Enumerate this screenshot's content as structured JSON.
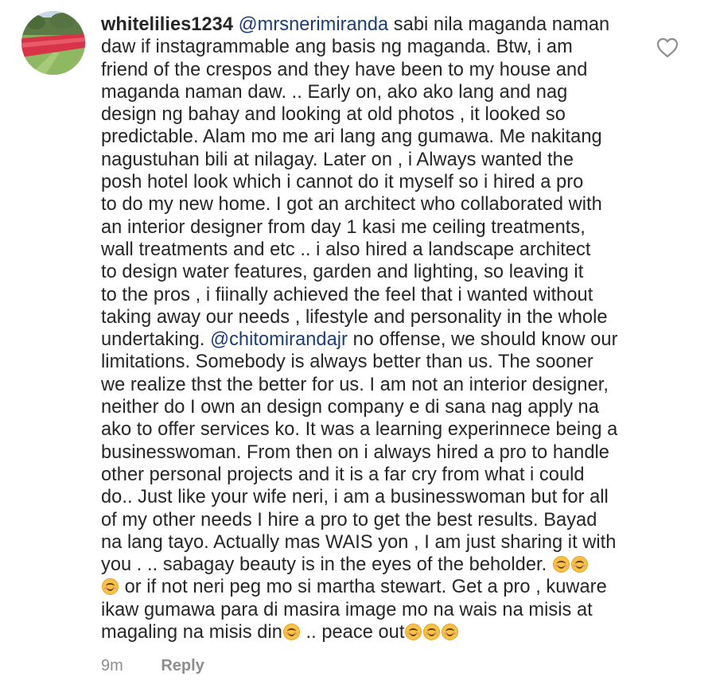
{
  "comment": {
    "username": "whitelilies1234",
    "mention_1": "@mrsnerimiranda",
    "mention_2": "@chitomirandajr",
    "lines": [
      " sabi nila maganda naman",
      "daw if instagrammable ang basis ng maganda. Btw, i am",
      "friend of the crespos and they have been to my house and",
      "maganda naman daw. .. Early on, ako ako lang and nag",
      "design ng bahay and looking at old photos , it looked so",
      "predictable. Alam mo me ari lang ang gumawa. Me nakitang",
      "nagustuhan bili at nilagay.  Later on , i Always wanted the",
      "posh hotel look which i cannot do it myself so i hired a pro",
      "to do my new home. I got an architect who collaborated with",
      "an interior designer from day 1 kasi me ceiling treatments,",
      "wall treatments and etc .. i also hired a landscape architect",
      "to design water features,  garden and lighting, so leaving it",
      "to the pros , i fiinally achieved the feel that i wanted without",
      "taking away our needs , lifestyle and personality in the whole",
      "undertaking. ",
      " no offense, we should know our",
      "limitations. Somebody is always better than us. The sooner",
      "we realize thst the better for us. I am not an interior designer,",
      "neither do I own an design company e di sana nag apply na",
      "ako to offer services ko. It was a learning experinnece being a",
      "businesswoman. From then on i always hired a pro to handle",
      "other personal projects and it is a far cry from what i could",
      "do.. Just like your wife neri, i am a businesswoman but for all",
      "of my other needs I hire a pro to get the best results. Bayad",
      "na lang tayo. Actually mas WAIS yon , I am just sharing it with",
      "you . .. sabagay beauty is in the eyes of the beholder. ",
      " or if not neri peg mo si martha stewart. Get a pro , kuware",
      "ikaw gumawa para di masira image mo na wais na misis at",
      "magaling na misis din",
      " .. peace out"
    ],
    "timestamp": "9m",
    "reply_label": "Reply"
  },
  "icons": {
    "like": "heart-outline-icon",
    "emoji": "smiling-face-emoji"
  },
  "colors": {
    "text": "#262626",
    "mention": "#1a3d7a",
    "meta": "#8e8e8e"
  }
}
